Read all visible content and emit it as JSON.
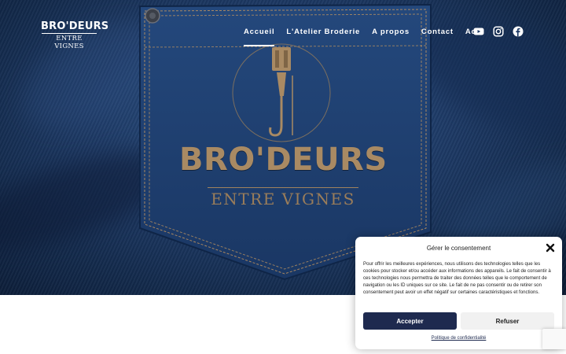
{
  "logo": {
    "title": "BRO'DEURS",
    "subtitle": "ENTRE VIGNES"
  },
  "nav": {
    "items": [
      {
        "label": "Accueil",
        "active": true
      },
      {
        "label": "L'Atelier Broderie",
        "active": false
      },
      {
        "label": "A propos",
        "active": false
      },
      {
        "label": "Contact",
        "active": false
      },
      {
        "label": "Actu",
        "active": false
      }
    ]
  },
  "social": {
    "icons": [
      "youtube-icon",
      "instagram-icon",
      "facebook-icon"
    ]
  },
  "hero": {
    "embroidery_title": "BRO'DEURS",
    "embroidery_subtitle": "ENTRE VIGNES"
  },
  "consent": {
    "title": "Gérer le consentement",
    "body": "Pour offrir les meilleures expériences, nous utilisons des technologies telles que les cookies pour stocker et/ou accéder aux informations des appareils. Le fait de consentir à ces technologies nous permettra de traiter des données telles que le comportement de navigation ou les ID uniques sur ce site. Le fait de ne pas consentir ou de retirer son consentement peut avoir un effet négatif sur certaines caractéristiques et fonctions.",
    "accept_label": "Accepter",
    "refuse_label": "Refuser",
    "policy_link": "Politique de confidentialité"
  },
  "colors": {
    "denim": "#1d3a66",
    "thread": "#a98a63",
    "accent": "#1e2a4f"
  }
}
